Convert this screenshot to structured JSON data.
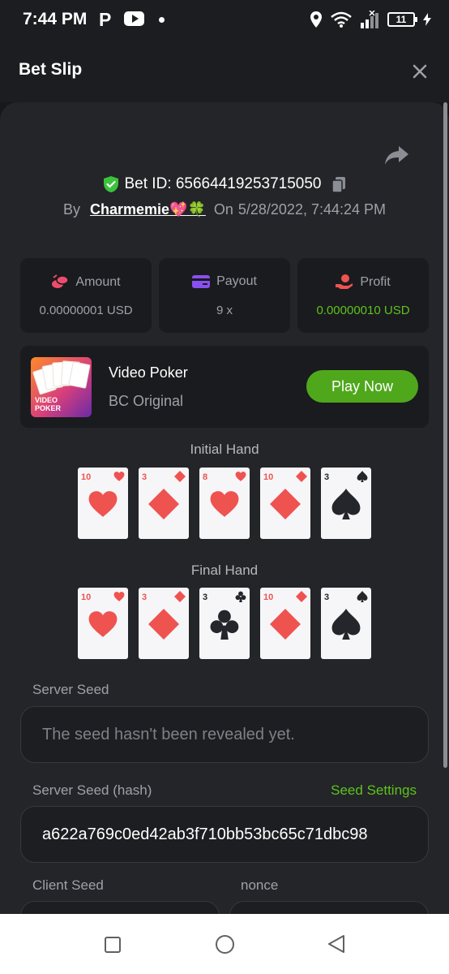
{
  "status_bar": {
    "time": "7:44 PM",
    "p_glyph": "P",
    "battery": "11",
    "icons": [
      "p-app-icon",
      "youtube-icon",
      "dot-icon",
      "location-icon",
      "wifi-icon",
      "signal-icon",
      "battery-icon",
      "charging-icon"
    ]
  },
  "header": {
    "title": "Bet Slip",
    "close_icon": "close-icon"
  },
  "bet": {
    "id_text": "Bet ID: 656644192537150​50",
    "id_label": "Bet ID: 65664419253715050",
    "by_label": "By",
    "username": "Charmemie💖🍀",
    "on_label": "On",
    "datetime": "5/28/2022, 7:44:24 PM"
  },
  "stats": [
    {
      "label": "Amount",
      "value": "0.00000001 USD",
      "icon": "coins-icon",
      "color": "#ef4b6c"
    },
    {
      "label": "Payout",
      "value": "9 x",
      "icon": "card-icon",
      "color": "#8a4ff0"
    },
    {
      "label": "Profit",
      "value": "0.00000010 USD",
      "icon": "hand-coin-icon",
      "color": "#ef5350"
    }
  ],
  "game": {
    "thumb_text_1": "VIDEO",
    "thumb_text_2": "POKER",
    "name": "Video Poker",
    "subtitle": "BC Original",
    "play_label": "Play Now"
  },
  "hands": {
    "initial_title": "Initial Hand",
    "final_title": "Final Hand",
    "initial": [
      {
        "rank": "10",
        "suit": "heart"
      },
      {
        "rank": "3",
        "suit": "diamond"
      },
      {
        "rank": "8",
        "suit": "heart"
      },
      {
        "rank": "10",
        "suit": "diamond"
      },
      {
        "rank": "3",
        "suit": "spade"
      }
    ],
    "final": [
      {
        "rank": "10",
        "suit": "heart"
      },
      {
        "rank": "3",
        "suit": "diamond"
      },
      {
        "rank": "3",
        "suit": "club"
      },
      {
        "rank": "10",
        "suit": "diamond"
      },
      {
        "rank": "3",
        "suit": "spade"
      }
    ]
  },
  "seeds": {
    "server_seed_label": "Server Seed",
    "server_seed_placeholder": "The seed hasn't been revealed yet.",
    "server_hash_label": "Server Seed (hash)",
    "seed_settings_link": "Seed Settings",
    "server_hash_value": "a622a769c0ed42ab3f710bb53bc65c71dbc98",
    "client_seed_label": "Client Seed",
    "nonce_label": "nonce"
  },
  "colors": {
    "accent_green": "#5ec21f",
    "button_green": "#4fa81c",
    "panel": "#232528",
    "card_red": "#ef5350"
  }
}
